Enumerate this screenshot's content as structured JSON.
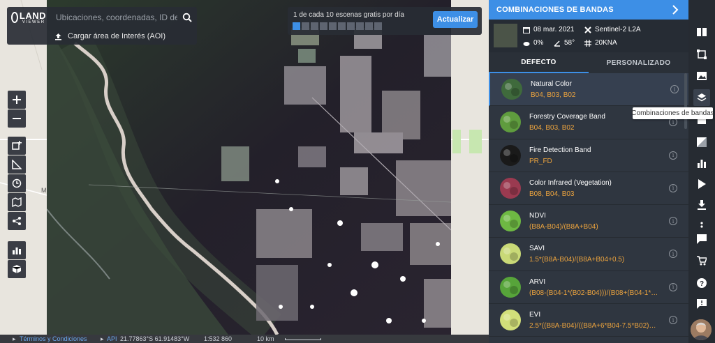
{
  "app": {
    "logo_main": "LAND",
    "logo_sub": "VIEWER"
  },
  "search": {
    "placeholder": "Ubicaciones, coordenadas, ID de e...",
    "aoi_label": "Cargar área de Interés (AOI)"
  },
  "scenes": {
    "counter_text": "1 de cada 10 escenas gratis por día",
    "used": 1,
    "total": 10,
    "update_label": "Actualizar"
  },
  "footer": {
    "terms": "Términos y Condiciones",
    "api": "API",
    "coords": "21.77863°S 61.91483°W",
    "scale_ratio": "1:532 860",
    "scale_label": "10 km"
  },
  "map": {
    "place_label": "M"
  },
  "panel": {
    "title": "COMBINACIONES DE BANDAS",
    "scene": {
      "date": "08 mar. 2021",
      "satellite": "Sentinel-2 L2A",
      "clouds": "0%",
      "angle": "58°",
      "tile": "20KNA"
    },
    "tabs": [
      {
        "label": "DEFECTO",
        "active": true
      },
      {
        "label": "PERSONALIZADO",
        "active": false
      }
    ],
    "bands": [
      {
        "name": "Natural Color",
        "formula": "B04, B03, B02",
        "color": "#3f6a3c",
        "selected": true
      },
      {
        "name": "Forestry Coverage Band",
        "formula": "B04, B03, B02",
        "color": "#5f9c3e"
      },
      {
        "name": "Fire Detection Band",
        "formula": "PR_FD",
        "color": "#1a1a1a"
      },
      {
        "name": "Color Infrared (Vegetation)",
        "formula": "B08, B04, B03",
        "color": "#9a3a50"
      },
      {
        "name": "NDVI",
        "formula": "(B8A-B04)/(B8A+B04)",
        "color": "#6eb843"
      },
      {
        "name": "SAVI",
        "formula": "1.5*(B8A-B04)/(B8A+B04+0.5)",
        "color": "#c9d977"
      },
      {
        "name": "ARVI",
        "formula": "(B08-(B04-1*(B02-B04)))/(B08+(B04-1*(...",
        "color": "#57a43a"
      },
      {
        "name": "EVI",
        "formula": "2.5*((B8A-B04)/((B8A+6*B04-7.5*B02)+...",
        "color": "#d2df7a"
      }
    ]
  },
  "tooltip": {
    "text": "Combinaciones de bandas"
  },
  "colors": {
    "accent": "#3d8fe6",
    "formula": "#eba33e",
    "panel_bg": "#2f3640"
  }
}
